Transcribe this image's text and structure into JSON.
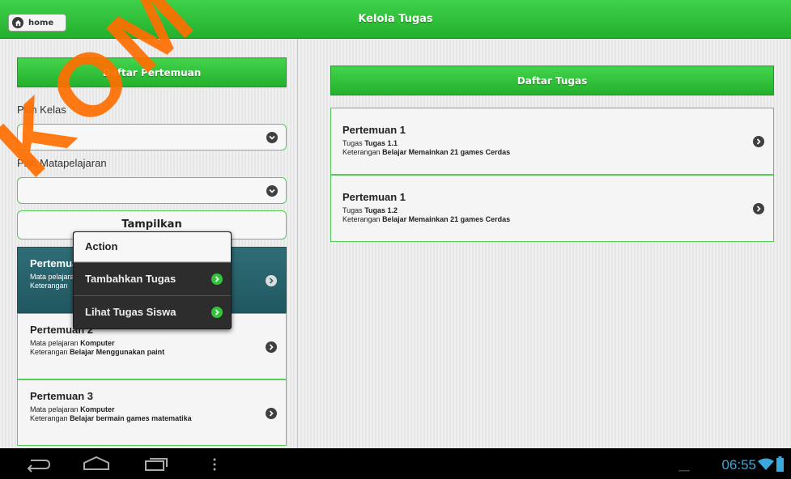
{
  "header": {
    "home_label": "home",
    "title": "Kelola Tugas"
  },
  "left": {
    "section_title": "Daftar Pertemuan",
    "kelas_label": "Pilih Kelas",
    "mapel_label": "Pilih Matapelajaran",
    "button_label": "Tampilkan",
    "items": [
      {
        "title": "Pertemuan 1",
        "line1_prefix": "Mata pelajaran",
        "line1_value": "",
        "line2_prefix": "Keterangan",
        "line2_value": ""
      },
      {
        "title": "Pertemuan 2",
        "line1_prefix": "Mata pelajaran",
        "line1_value": "Komputer",
        "line2_prefix": "Keterangan",
        "line2_value": "Belajar Menggunakan paint"
      },
      {
        "title": "Pertemuan 3",
        "line1_prefix": "Mata pelajaran",
        "line1_value": "Komputer",
        "line2_prefix": "Keterangan",
        "line2_value": "Belajar bermain games matematika"
      }
    ]
  },
  "right": {
    "section_title": "Daftar Tugas",
    "tasks": [
      {
        "title": "Pertemuan 1",
        "line1_prefix": "Tugas",
        "line1_value": "Tugas 1.1",
        "line2_prefix": "Keterangan",
        "line2_value": "Belajar Memainkan 21 games Cerdas"
      },
      {
        "title": "Pertemuan 1",
        "line1_prefix": "Tugas",
        "line1_value": "Tugas 1.2",
        "line2_prefix": "Keterangan",
        "line2_value": "Belajar Memainkan 21 games Cerdas"
      }
    ]
  },
  "popup": {
    "header": "Action",
    "items": [
      "Tambahkan Tugas",
      "Lihat Tugas Siswa"
    ]
  },
  "statusbar": {
    "time": "06:55"
  },
  "watermark": "KOM",
  "colors": {
    "accent_green": "#2cc236",
    "selected_item": "#2a6670",
    "clock_blue": "#3aa8dc"
  }
}
